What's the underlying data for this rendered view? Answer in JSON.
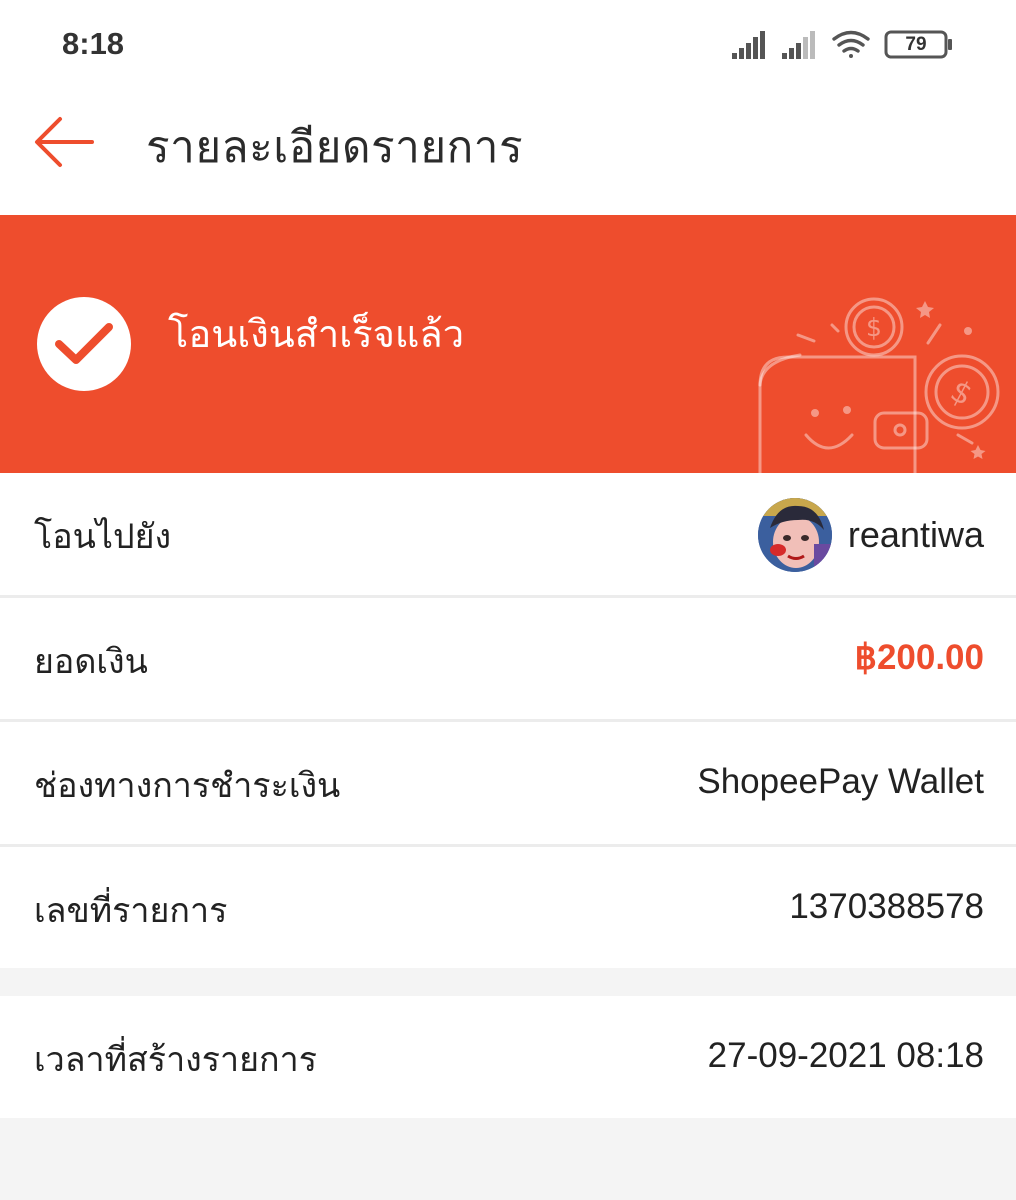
{
  "status_bar": {
    "time": "8:18",
    "battery_level": "79",
    "icons": [
      "signal-icon",
      "signal-icon-2",
      "wifi-icon",
      "battery-icon"
    ]
  },
  "header": {
    "back_icon": "arrow-left-icon",
    "title": "รายละเอียดรายการ"
  },
  "banner": {
    "status_icon": "check-circle-icon",
    "status_text": "โอนเงินสำเร็จแล้ว",
    "illustration": "wallet-coins-icon",
    "background_color": "#ee4d2d"
  },
  "details": {
    "recipient": {
      "label": "โอนไปยัง",
      "value": "reantiwa"
    },
    "amount": {
      "label": "ยอดเงิน",
      "value": "฿200.00",
      "color": "#ee4d2d"
    },
    "payment_method": {
      "label": "ช่องทางการชำระเงิน",
      "value": "ShopeePay Wallet"
    },
    "transaction_id": {
      "label": "เลขที่รายการ",
      "value": "1370388578"
    },
    "created_time": {
      "label": "เวลาที่สร้างรายการ",
      "value": "27-09-2021 08:18"
    }
  }
}
